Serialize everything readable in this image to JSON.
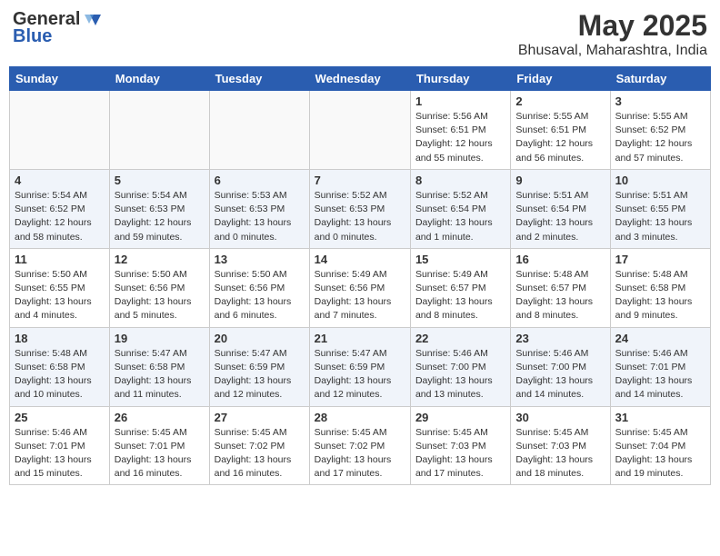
{
  "header": {
    "logo_general": "General",
    "logo_blue": "Blue",
    "month_year": "May 2025",
    "location": "Bhusaval, Maharashtra, India"
  },
  "weekdays": [
    "Sunday",
    "Monday",
    "Tuesday",
    "Wednesday",
    "Thursday",
    "Friday",
    "Saturday"
  ],
  "weeks": [
    [
      {
        "day": "",
        "info": ""
      },
      {
        "day": "",
        "info": ""
      },
      {
        "day": "",
        "info": ""
      },
      {
        "day": "",
        "info": ""
      },
      {
        "day": "1",
        "info": "Sunrise: 5:56 AM\nSunset: 6:51 PM\nDaylight: 12 hours\nand 55 minutes."
      },
      {
        "day": "2",
        "info": "Sunrise: 5:55 AM\nSunset: 6:51 PM\nDaylight: 12 hours\nand 56 minutes."
      },
      {
        "day": "3",
        "info": "Sunrise: 5:55 AM\nSunset: 6:52 PM\nDaylight: 12 hours\nand 57 minutes."
      }
    ],
    [
      {
        "day": "4",
        "info": "Sunrise: 5:54 AM\nSunset: 6:52 PM\nDaylight: 12 hours\nand 58 minutes."
      },
      {
        "day": "5",
        "info": "Sunrise: 5:54 AM\nSunset: 6:53 PM\nDaylight: 12 hours\nand 59 minutes."
      },
      {
        "day": "6",
        "info": "Sunrise: 5:53 AM\nSunset: 6:53 PM\nDaylight: 13 hours\nand 0 minutes."
      },
      {
        "day": "7",
        "info": "Sunrise: 5:52 AM\nSunset: 6:53 PM\nDaylight: 13 hours\nand 0 minutes."
      },
      {
        "day": "8",
        "info": "Sunrise: 5:52 AM\nSunset: 6:54 PM\nDaylight: 13 hours\nand 1 minute."
      },
      {
        "day": "9",
        "info": "Sunrise: 5:51 AM\nSunset: 6:54 PM\nDaylight: 13 hours\nand 2 minutes."
      },
      {
        "day": "10",
        "info": "Sunrise: 5:51 AM\nSunset: 6:55 PM\nDaylight: 13 hours\nand 3 minutes."
      }
    ],
    [
      {
        "day": "11",
        "info": "Sunrise: 5:50 AM\nSunset: 6:55 PM\nDaylight: 13 hours\nand 4 minutes."
      },
      {
        "day": "12",
        "info": "Sunrise: 5:50 AM\nSunset: 6:56 PM\nDaylight: 13 hours\nand 5 minutes."
      },
      {
        "day": "13",
        "info": "Sunrise: 5:50 AM\nSunset: 6:56 PM\nDaylight: 13 hours\nand 6 minutes."
      },
      {
        "day": "14",
        "info": "Sunrise: 5:49 AM\nSunset: 6:56 PM\nDaylight: 13 hours\nand 7 minutes."
      },
      {
        "day": "15",
        "info": "Sunrise: 5:49 AM\nSunset: 6:57 PM\nDaylight: 13 hours\nand 8 minutes."
      },
      {
        "day": "16",
        "info": "Sunrise: 5:48 AM\nSunset: 6:57 PM\nDaylight: 13 hours\nand 8 minutes."
      },
      {
        "day": "17",
        "info": "Sunrise: 5:48 AM\nSunset: 6:58 PM\nDaylight: 13 hours\nand 9 minutes."
      }
    ],
    [
      {
        "day": "18",
        "info": "Sunrise: 5:48 AM\nSunset: 6:58 PM\nDaylight: 13 hours\nand 10 minutes."
      },
      {
        "day": "19",
        "info": "Sunrise: 5:47 AM\nSunset: 6:58 PM\nDaylight: 13 hours\nand 11 minutes."
      },
      {
        "day": "20",
        "info": "Sunrise: 5:47 AM\nSunset: 6:59 PM\nDaylight: 13 hours\nand 12 minutes."
      },
      {
        "day": "21",
        "info": "Sunrise: 5:47 AM\nSunset: 6:59 PM\nDaylight: 13 hours\nand 12 minutes."
      },
      {
        "day": "22",
        "info": "Sunrise: 5:46 AM\nSunset: 7:00 PM\nDaylight: 13 hours\nand 13 minutes."
      },
      {
        "day": "23",
        "info": "Sunrise: 5:46 AM\nSunset: 7:00 PM\nDaylight: 13 hours\nand 14 minutes."
      },
      {
        "day": "24",
        "info": "Sunrise: 5:46 AM\nSunset: 7:01 PM\nDaylight: 13 hours\nand 14 minutes."
      }
    ],
    [
      {
        "day": "25",
        "info": "Sunrise: 5:46 AM\nSunset: 7:01 PM\nDaylight: 13 hours\nand 15 minutes."
      },
      {
        "day": "26",
        "info": "Sunrise: 5:45 AM\nSunset: 7:01 PM\nDaylight: 13 hours\nand 16 minutes."
      },
      {
        "day": "27",
        "info": "Sunrise: 5:45 AM\nSunset: 7:02 PM\nDaylight: 13 hours\nand 16 minutes."
      },
      {
        "day": "28",
        "info": "Sunrise: 5:45 AM\nSunset: 7:02 PM\nDaylight: 13 hours\nand 17 minutes."
      },
      {
        "day": "29",
        "info": "Sunrise: 5:45 AM\nSunset: 7:03 PM\nDaylight: 13 hours\nand 17 minutes."
      },
      {
        "day": "30",
        "info": "Sunrise: 5:45 AM\nSunset: 7:03 PM\nDaylight: 13 hours\nand 18 minutes."
      },
      {
        "day": "31",
        "info": "Sunrise: 5:45 AM\nSunset: 7:04 PM\nDaylight: 13 hours\nand 19 minutes."
      }
    ]
  ]
}
